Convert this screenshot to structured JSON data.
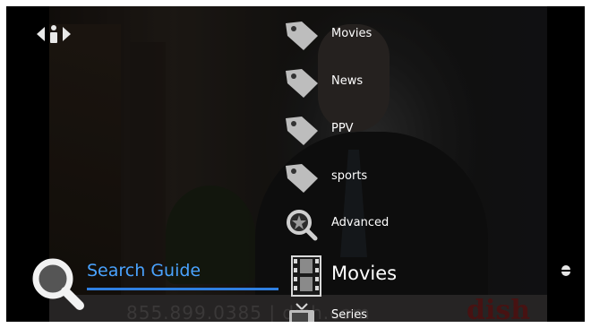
{
  "menu": {
    "items": [
      {
        "label": "Movies",
        "icon": "tag-icon"
      },
      {
        "label": "News",
        "icon": "tag-icon"
      },
      {
        "label": "PPV",
        "icon": "tag-icon"
      },
      {
        "label": "sports",
        "icon": "tag-icon"
      },
      {
        "label": "Advanced",
        "icon": "advanced-search-icon"
      }
    ],
    "selected": {
      "label": "Movies",
      "icon": "film-icon"
    },
    "next": {
      "label": "Series",
      "icon": "tv-icon"
    }
  },
  "search_guide": {
    "label": "Search Guide",
    "accent": "#4aa3ff"
  },
  "video": {
    "phone": "855.899.0385 | dish.com",
    "brand": "dish"
  },
  "colors": {
    "accent": "#2f7fe0",
    "background": "#000000"
  }
}
